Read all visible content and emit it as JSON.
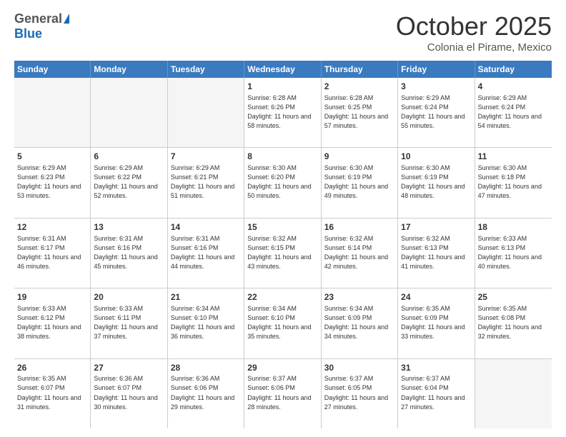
{
  "header": {
    "logo_general": "General",
    "logo_blue": "Blue",
    "month_title": "October 2025",
    "location": "Colonia el Pirame, Mexico"
  },
  "weekdays": [
    "Sunday",
    "Monday",
    "Tuesday",
    "Wednesday",
    "Thursday",
    "Friday",
    "Saturday"
  ],
  "weeks": [
    [
      {
        "day": "",
        "sunrise": "",
        "sunset": "",
        "daylight": "",
        "empty": true
      },
      {
        "day": "",
        "sunrise": "",
        "sunset": "",
        "daylight": "",
        "empty": true
      },
      {
        "day": "",
        "sunrise": "",
        "sunset": "",
        "daylight": "",
        "empty": true
      },
      {
        "day": "1",
        "sunrise": "6:28 AM",
        "sunset": "6:26 PM",
        "daylight": "11 hours and 58 minutes."
      },
      {
        "day": "2",
        "sunrise": "6:28 AM",
        "sunset": "6:25 PM",
        "daylight": "11 hours and 57 minutes."
      },
      {
        "day": "3",
        "sunrise": "6:29 AM",
        "sunset": "6:24 PM",
        "daylight": "11 hours and 55 minutes."
      },
      {
        "day": "4",
        "sunrise": "6:29 AM",
        "sunset": "6:24 PM",
        "daylight": "11 hours and 54 minutes."
      }
    ],
    [
      {
        "day": "5",
        "sunrise": "6:29 AM",
        "sunset": "6:23 PM",
        "daylight": "11 hours and 53 minutes."
      },
      {
        "day": "6",
        "sunrise": "6:29 AM",
        "sunset": "6:22 PM",
        "daylight": "11 hours and 52 minutes."
      },
      {
        "day": "7",
        "sunrise": "6:29 AM",
        "sunset": "6:21 PM",
        "daylight": "11 hours and 51 minutes."
      },
      {
        "day": "8",
        "sunrise": "6:30 AM",
        "sunset": "6:20 PM",
        "daylight": "11 hours and 50 minutes."
      },
      {
        "day": "9",
        "sunrise": "6:30 AM",
        "sunset": "6:19 PM",
        "daylight": "11 hours and 49 minutes."
      },
      {
        "day": "10",
        "sunrise": "6:30 AM",
        "sunset": "6:19 PM",
        "daylight": "11 hours and 48 minutes."
      },
      {
        "day": "11",
        "sunrise": "6:30 AM",
        "sunset": "6:18 PM",
        "daylight": "11 hours and 47 minutes."
      }
    ],
    [
      {
        "day": "12",
        "sunrise": "6:31 AM",
        "sunset": "6:17 PM",
        "daylight": "11 hours and 46 minutes."
      },
      {
        "day": "13",
        "sunrise": "6:31 AM",
        "sunset": "6:16 PM",
        "daylight": "11 hours and 45 minutes."
      },
      {
        "day": "14",
        "sunrise": "6:31 AM",
        "sunset": "6:16 PM",
        "daylight": "11 hours and 44 minutes."
      },
      {
        "day": "15",
        "sunrise": "6:32 AM",
        "sunset": "6:15 PM",
        "daylight": "11 hours and 43 minutes."
      },
      {
        "day": "16",
        "sunrise": "6:32 AM",
        "sunset": "6:14 PM",
        "daylight": "11 hours and 42 minutes."
      },
      {
        "day": "17",
        "sunrise": "6:32 AM",
        "sunset": "6:13 PM",
        "daylight": "11 hours and 41 minutes."
      },
      {
        "day": "18",
        "sunrise": "6:33 AM",
        "sunset": "6:13 PM",
        "daylight": "11 hours and 40 minutes."
      }
    ],
    [
      {
        "day": "19",
        "sunrise": "6:33 AM",
        "sunset": "6:12 PM",
        "daylight": "11 hours and 38 minutes."
      },
      {
        "day": "20",
        "sunrise": "6:33 AM",
        "sunset": "6:11 PM",
        "daylight": "11 hours and 37 minutes."
      },
      {
        "day": "21",
        "sunrise": "6:34 AM",
        "sunset": "6:10 PM",
        "daylight": "11 hours and 36 minutes."
      },
      {
        "day": "22",
        "sunrise": "6:34 AM",
        "sunset": "6:10 PM",
        "daylight": "11 hours and 35 minutes."
      },
      {
        "day": "23",
        "sunrise": "6:34 AM",
        "sunset": "6:09 PM",
        "daylight": "11 hours and 34 minutes."
      },
      {
        "day": "24",
        "sunrise": "6:35 AM",
        "sunset": "6:09 PM",
        "daylight": "11 hours and 33 minutes."
      },
      {
        "day": "25",
        "sunrise": "6:35 AM",
        "sunset": "6:08 PM",
        "daylight": "11 hours and 32 minutes."
      }
    ],
    [
      {
        "day": "26",
        "sunrise": "6:35 AM",
        "sunset": "6:07 PM",
        "daylight": "11 hours and 31 minutes."
      },
      {
        "day": "27",
        "sunrise": "6:36 AM",
        "sunset": "6:07 PM",
        "daylight": "11 hours and 30 minutes."
      },
      {
        "day": "28",
        "sunrise": "6:36 AM",
        "sunset": "6:06 PM",
        "daylight": "11 hours and 29 minutes."
      },
      {
        "day": "29",
        "sunrise": "6:37 AM",
        "sunset": "6:06 PM",
        "daylight": "11 hours and 28 minutes."
      },
      {
        "day": "30",
        "sunrise": "6:37 AM",
        "sunset": "6:05 PM",
        "daylight": "11 hours and 27 minutes."
      },
      {
        "day": "31",
        "sunrise": "6:37 AM",
        "sunset": "6:04 PM",
        "daylight": "11 hours and 27 minutes."
      },
      {
        "day": "",
        "sunrise": "",
        "sunset": "",
        "daylight": "",
        "empty": true
      }
    ]
  ]
}
